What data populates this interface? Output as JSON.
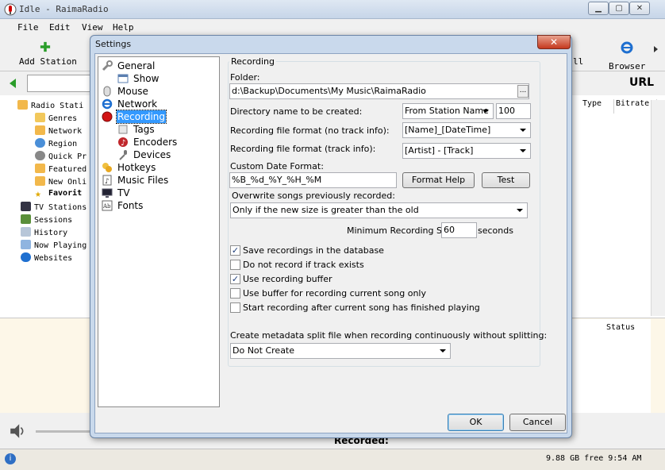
{
  "main": {
    "title": "Idle - RaimaRadio",
    "menu": [
      "File",
      "Edit",
      "View",
      "Help"
    ],
    "toolbar": {
      "add_station": "Add Station",
      "partial_label": "ll",
      "browser": "Browser"
    },
    "url_header": "URL",
    "tree": [
      {
        "label": "Radio Stati",
        "icon": "radio-folder-icon"
      },
      {
        "label": "Genres",
        "icon": "folder-icon"
      },
      {
        "label": "Network",
        "icon": "network-icon"
      },
      {
        "label": "Region",
        "icon": "globe-icon"
      },
      {
        "label": "Quick Pr",
        "icon": "quick-icon"
      },
      {
        "label": "Featured",
        "icon": "folder-icon"
      },
      {
        "label": "New Onli",
        "icon": "folder-icon"
      },
      {
        "label": "Favorit",
        "icon": "star-icon"
      },
      {
        "label": "TV Stations",
        "icon": "tv-icon"
      },
      {
        "label": "Sessions",
        "icon": "sessions-icon"
      },
      {
        "label": "History",
        "icon": "history-icon"
      },
      {
        "label": "Now Playing",
        "icon": "now-playing-icon"
      },
      {
        "label": "Websites",
        "icon": "ie-icon"
      }
    ],
    "columns": {
      "type": "Type",
      "bitrate": "Bitrate",
      "status": "Status"
    },
    "recorded_label": "Recorded:",
    "status_bar": "9.88 GB free 9:54 AM"
  },
  "settings": {
    "title": "Settings",
    "close_glyph": "✕",
    "nav": [
      {
        "label": "General",
        "icon": "wrench-icon"
      },
      {
        "label": "Show",
        "icon": "window-icon"
      },
      {
        "label": "Mouse",
        "icon": "mouse-icon"
      },
      {
        "label": "Network",
        "icon": "ie-icon"
      },
      {
        "label": "Recording",
        "icon": "record-icon"
      },
      {
        "label": "Tags",
        "icon": "tag-icon"
      },
      {
        "label": "Encoders",
        "icon": "music-icon"
      },
      {
        "label": "Devices",
        "icon": "microphone-icon"
      },
      {
        "label": "Hotkeys",
        "icon": "hotkey-icon"
      },
      {
        "label": "Music Files",
        "icon": "music-files-icon"
      },
      {
        "label": "TV",
        "icon": "tv-icon"
      },
      {
        "label": "Fonts",
        "icon": "fonts-icon"
      }
    ],
    "recording": {
      "group_title": "Recording",
      "folder_label": "Folder:",
      "folder_value": "d:\\Backup\\Documents\\My Music\\RaimaRadio",
      "browse_label": "...",
      "dir_name_label": "Directory name to be created:",
      "dir_name_value": "From Station Name",
      "dir_name_number": "100",
      "format_no_info_label": "Recording file format (no track info):",
      "format_no_info_value": "[Name]_[DateTime]",
      "format_info_label": "Recording file format (track info):",
      "format_info_value": "[Artist] - [Track]",
      "custom_date_label": "Custom Date Format:",
      "custom_date_value": "%B_%d_%Y_%H_%M",
      "format_help_button": "Format Help",
      "test_button": "Test",
      "overwrite_label": "Overwrite songs previously recorded:",
      "overwrite_value": "Only if the new size is greater than the old",
      "min_size_label": "Minimum Recording Size:",
      "min_size_value": "60",
      "min_size_unit": "seconds",
      "checkboxes": [
        {
          "label": "Save recordings in the database",
          "checked": true
        },
        {
          "label": "Do not record if track exists",
          "checked": false
        },
        {
          "label": "Use recording buffer",
          "checked": true
        },
        {
          "label": "Use buffer for recording current song only",
          "checked": false
        },
        {
          "label": "Start recording after current song has finished playing",
          "checked": false
        }
      ],
      "metadata_label": "Create metadata split file when recording continuously without splitting:",
      "metadata_value": "Do Not Create"
    },
    "ok_button": "OK",
    "cancel_button": "Cancel"
  }
}
